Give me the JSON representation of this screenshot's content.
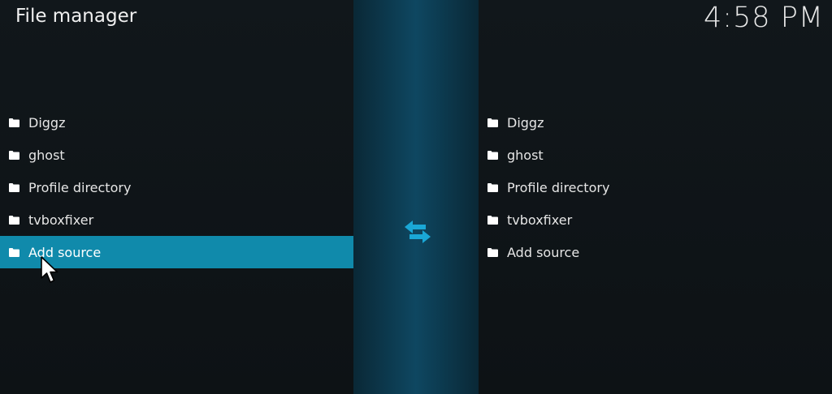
{
  "header": {
    "title": "File manager",
    "clock": "4:58 PM"
  },
  "left_pane": {
    "items": [
      {
        "label": "Diggz",
        "icon": "folder-icon"
      },
      {
        "label": "ghost",
        "icon": "folder-icon"
      },
      {
        "label": "Profile directory",
        "icon": "folder-icon"
      },
      {
        "label": "tvboxfixer",
        "icon": "folder-icon"
      },
      {
        "label": "Add source",
        "icon": "folder-icon",
        "focused": true
      }
    ]
  },
  "right_pane": {
    "items": [
      {
        "label": "Diggz",
        "icon": "folder-icon"
      },
      {
        "label": "ghost",
        "icon": "folder-icon"
      },
      {
        "label": "Profile directory",
        "icon": "folder-icon"
      },
      {
        "label": "tvboxfixer",
        "icon": "folder-icon"
      },
      {
        "label": "Add source",
        "icon": "folder-icon"
      }
    ]
  },
  "center": {
    "icon": "swap-arrows-icon"
  },
  "colors": {
    "background": "#0f1418",
    "focus": "#108aab",
    "accent": "#1aa7d6",
    "center_bar": "#0e4761"
  }
}
